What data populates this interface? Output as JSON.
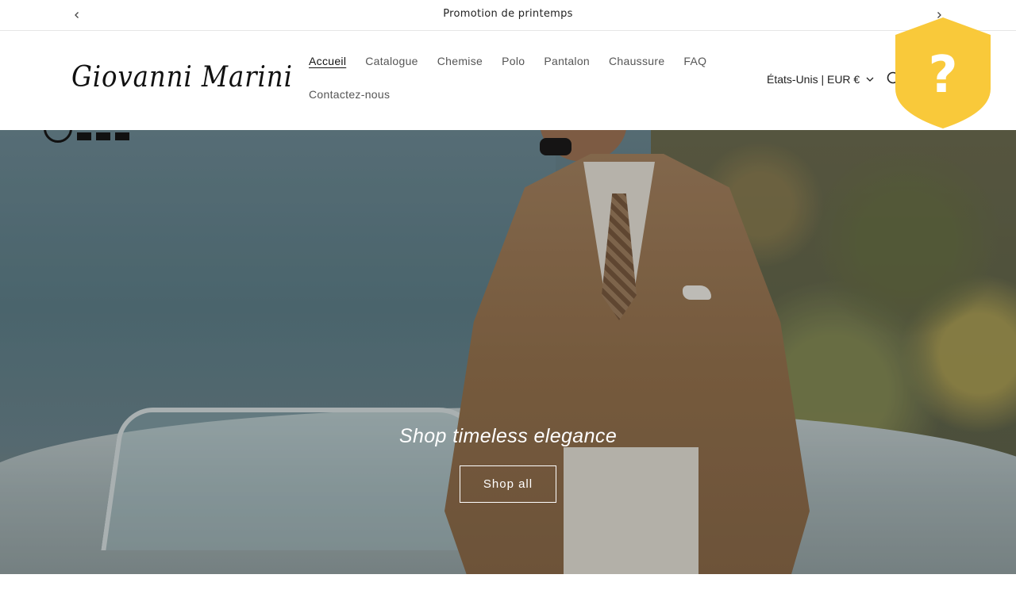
{
  "announcement": {
    "text": "Promotion de printemps",
    "prev_icon": "chevron-left-icon",
    "next_icon": "chevron-right-icon"
  },
  "header": {
    "logo_text": "Giovanni Marini",
    "nav": {
      "row1": [
        "Accueil",
        "Catalogue",
        "Chemise",
        "Polo",
        "Pantalon",
        "Chaussure",
        "FAQ"
      ],
      "row2": [
        "Contactez-nous"
      ],
      "active": "Accueil"
    },
    "locale": "États-Unis | EUR €",
    "search_icon": "search-icon"
  },
  "hero": {
    "title": "Shop timeless elegance",
    "button": "Shop all"
  },
  "shield_badge": {
    "icon": "question-mark-shield-icon",
    "symbol": "?",
    "color": "#f9c93a"
  },
  "colors": {
    "text": "#121212",
    "border": "#e6e6e6",
    "white": "#ffffff"
  }
}
